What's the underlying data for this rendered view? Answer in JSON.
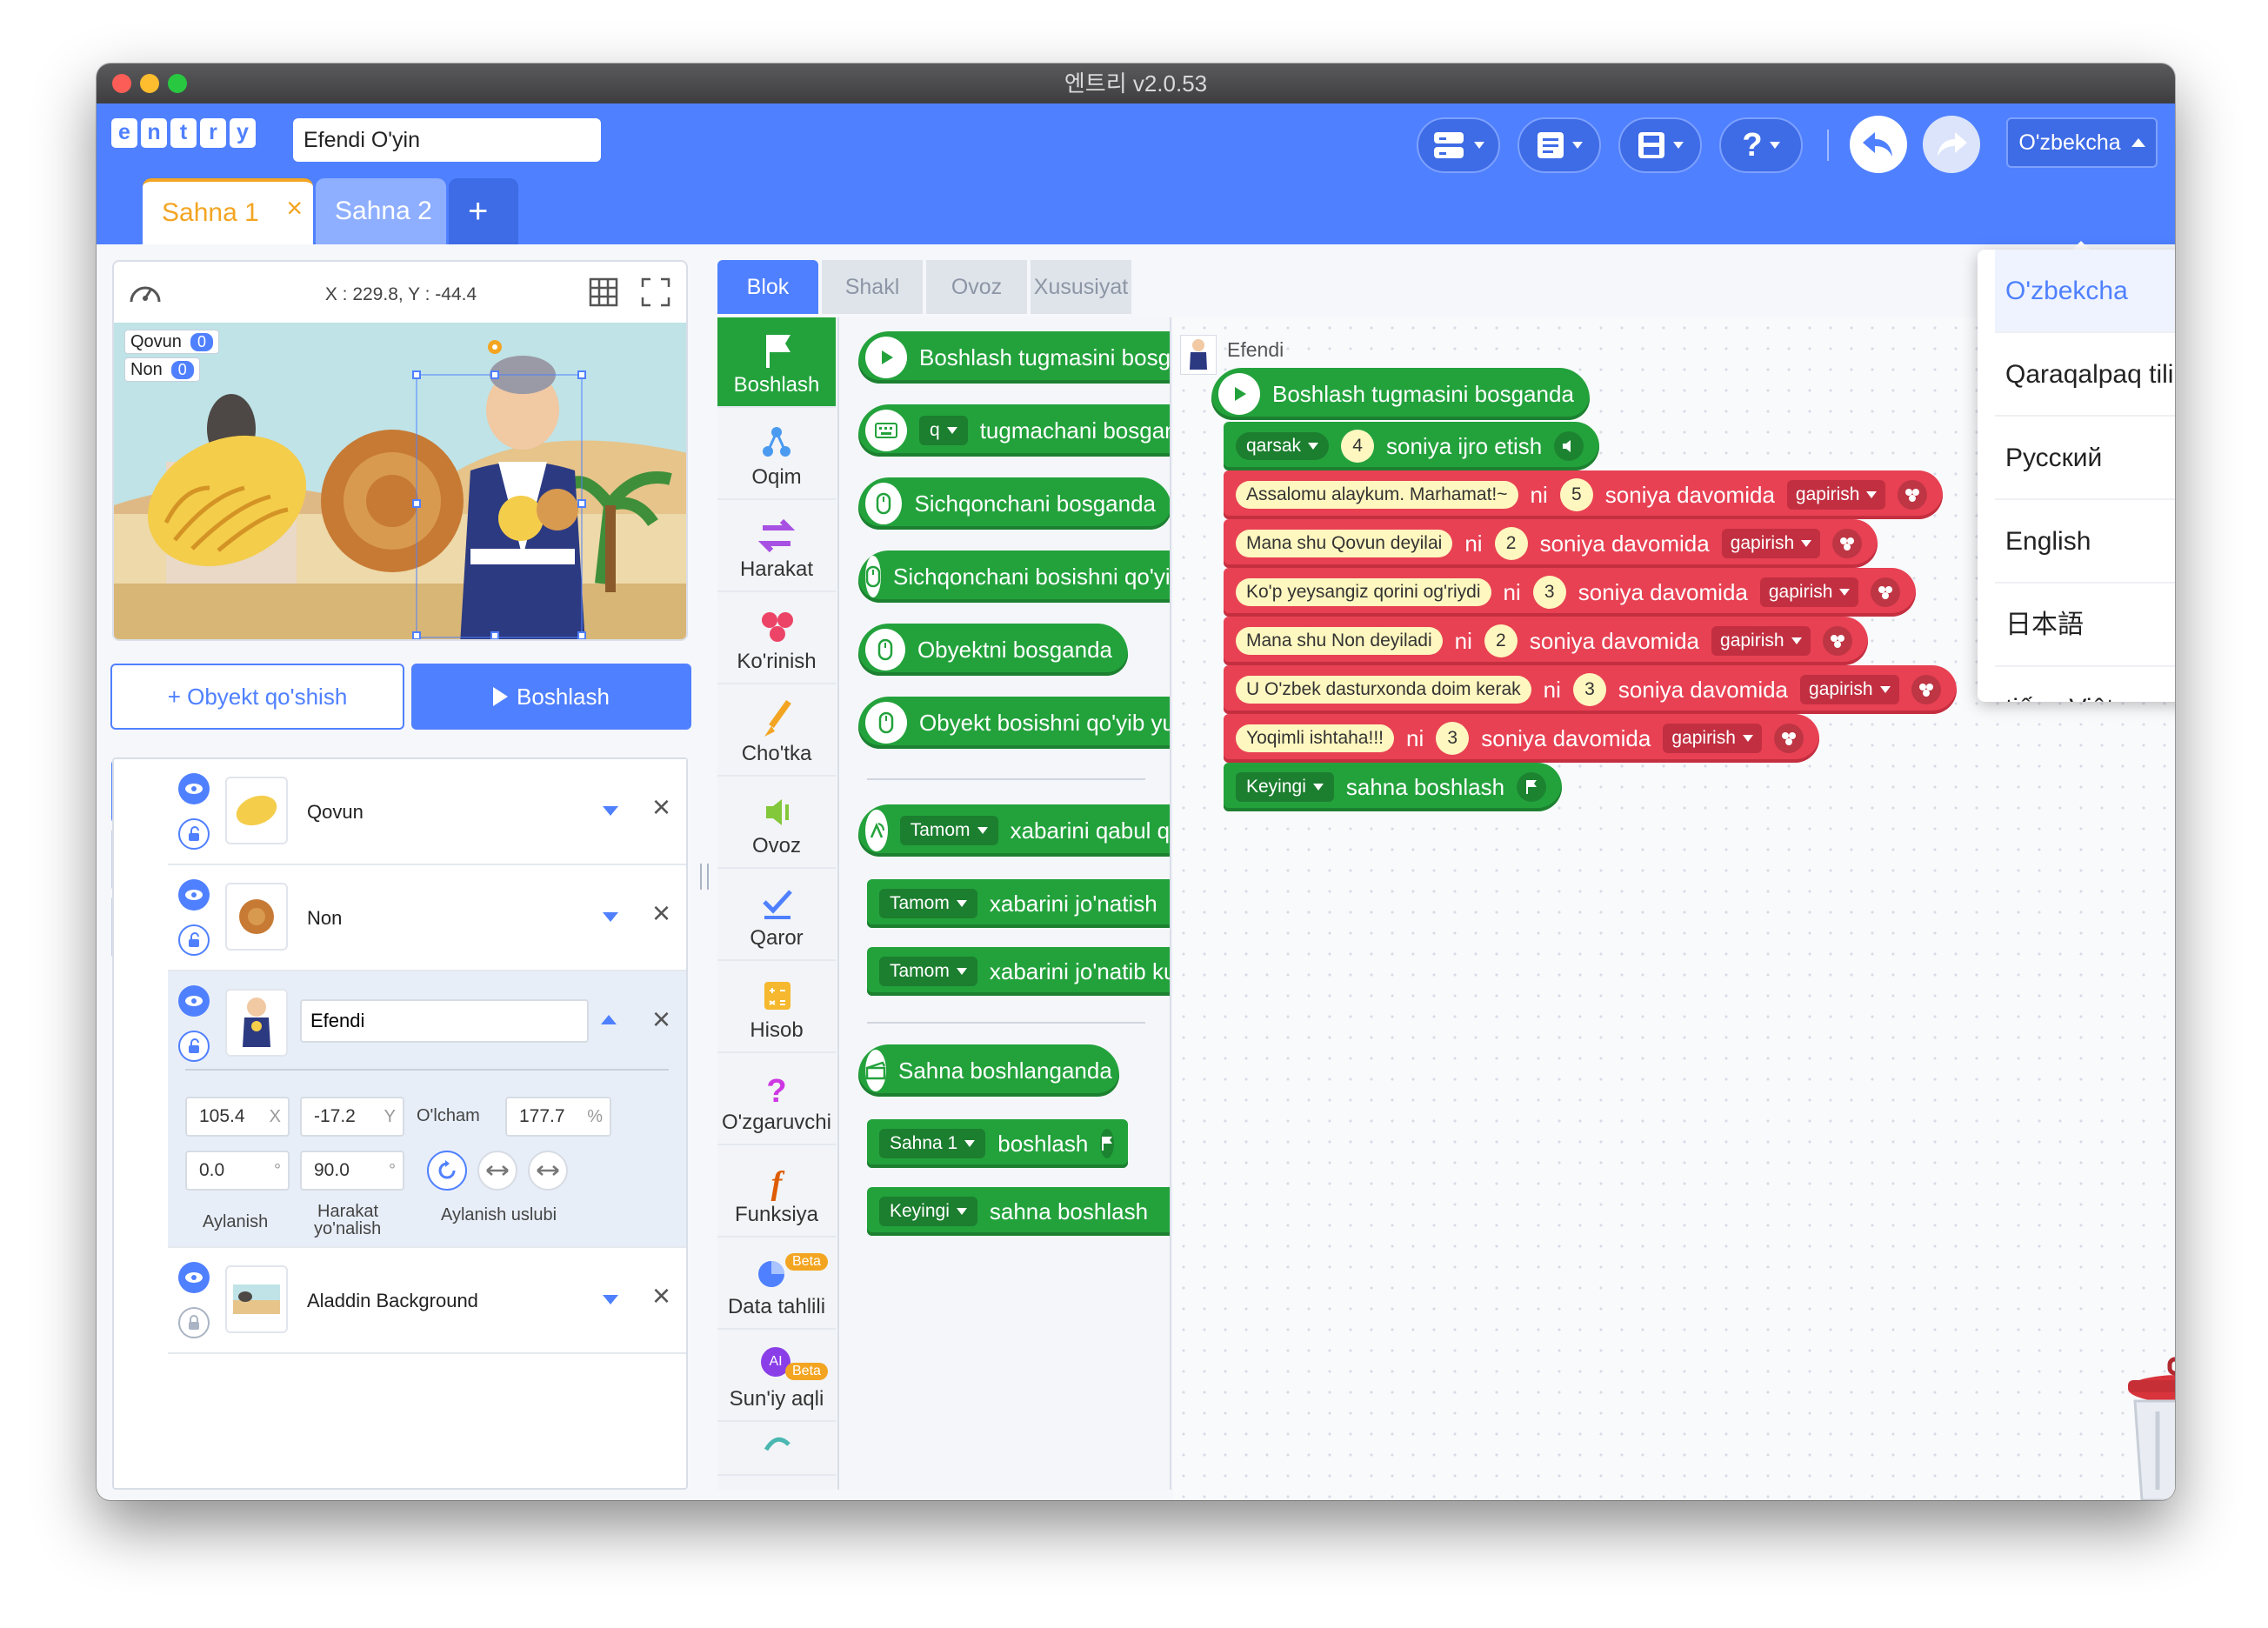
{
  "window": {
    "title": "엔트리 v2.0.53"
  },
  "toolbar": {
    "logo": [
      "e",
      "n",
      "t",
      "r",
      "y"
    ],
    "project_name": "Efendi O'yin",
    "icons": [
      "category-menu-icon",
      "list-menu-icon",
      "save-icon",
      "help-icon",
      "undo-icon",
      "redo-icon"
    ],
    "language": "O'zbekcha"
  },
  "scene_tabs": {
    "tabs": [
      "Sahna 1",
      "Sahna 2"
    ],
    "add": "+"
  },
  "stage": {
    "coords": "X : 229.8, Y : -44.4",
    "variables": [
      {
        "name": "Qovun",
        "value": "0"
      },
      {
        "name": "Non",
        "value": "0"
      }
    ]
  },
  "buttons": {
    "add_object": "+ Obyekt qo'shish",
    "start": "Boshlash"
  },
  "objects": {
    "items": [
      {
        "name": "Qovun"
      },
      {
        "name": "Non"
      },
      {
        "name": "Efendi"
      },
      {
        "name": "Aladdin Background"
      }
    ],
    "props": {
      "x": "105.4",
      "x_unit": "X",
      "y": "-17.2",
      "y_unit": "Y",
      "size_label": "O'lcham",
      "size": "177.7",
      "size_unit": "%",
      "rotation": "0.0",
      "direction": "90.0",
      "deg": "°",
      "rotation_label": "Aylanish",
      "direction_label_1": "Harakat",
      "direction_label_2": "yo'nalish",
      "rotation_style_label": "Aylanish uslubi"
    }
  },
  "block_tabs": [
    "Blok",
    "Shakl",
    "Ovoz",
    "Xususiyat"
  ],
  "categories": [
    {
      "label": "Boshlash",
      "color": "#ffffff"
    },
    {
      "label": "Oqim",
      "color": "#4a9af0"
    },
    {
      "label": "Harakat",
      "color": "#a751e3"
    },
    {
      "label": "Ko'rinish",
      "color": "#ec4466"
    },
    {
      "label": "Cho'tka",
      "color": "#f3a522"
    },
    {
      "label": "Ovoz",
      "color": "#83c73a"
    },
    {
      "label": "Qaror",
      "color": "#4f80ff"
    },
    {
      "label": "Hisob",
      "color": "#f5b82e"
    },
    {
      "label": "O'zgaruvchi",
      "color": "#ce38e3"
    },
    {
      "label": "Funksiya",
      "color": "#de5c04"
    },
    {
      "label": "Data tahlili",
      "color": "#4f80ff",
      "badge": "Beta"
    },
    {
      "label": "Sun'iy aqli",
      "color": "#8a3ee8",
      "badge": "Beta",
      "icon_text": "AI"
    }
  ],
  "palette": {
    "b1": "Boshlash tugmasini bosganda",
    "b2_key": "q",
    "b2": "tugmachani bosganda",
    "b3": "Sichqonchani bosganda",
    "b4": "Sichqonchani bosishni qo'yib yuborganda",
    "b5": "Obyektni bosganda",
    "b6": "Obyekt bosishni qo'yib yuborganda",
    "msg": "Tamom",
    "b7": "xabarini qabul qilganda",
    "b8": "xabarini jo'natish",
    "b9": "xabarini jo'natib kutish",
    "b10": "Sahna boshlanganda",
    "scene": "Sahna 1",
    "b11": "boshlash",
    "next": "Keyingi",
    "b12": "sahna boshlash"
  },
  "workspace": {
    "object_label": "Efendi",
    "hat": "Boshlash tugmasini bosganda",
    "sound": {
      "name": "qarsak",
      "seconds": "4",
      "text": "soniya ijro etish"
    },
    "ni": "ni",
    "seconds_label": "soniya davomida",
    "say": "gapirish",
    "says": [
      {
        "text": "Assalomu alaykum. Marhamat!~",
        "sec": "5"
      },
      {
        "text": "Mana shu Qovun deyilai",
        "sec": "2"
      },
      {
        "text": "Ko'p yeysangiz qorini og'riydi",
        "sec": "3"
      },
      {
        "text": "Mana shu Non deyiladi",
        "sec": "2"
      },
      {
        "text": "U O'zbek dasturxonda doim kerak",
        "sec": "3"
      },
      {
        "text": "Yoqimli ishtaha!!!",
        "sec": "3"
      }
    ],
    "next_scene": {
      "dd": "Keyingi",
      "text": "sahna boshlash"
    }
  },
  "language_menu": {
    "items": [
      "O'zbekcha",
      "Qaraqalpaq tili",
      "Русский",
      "English",
      "日本語",
      "tiếng Việt"
    ],
    "selected": "O'zbekcha"
  },
  "colors": {
    "brand": "#4f80ff",
    "flow_green": "#23a23c",
    "looks_red": "#e84153",
    "start_tab": "#f3a522"
  }
}
